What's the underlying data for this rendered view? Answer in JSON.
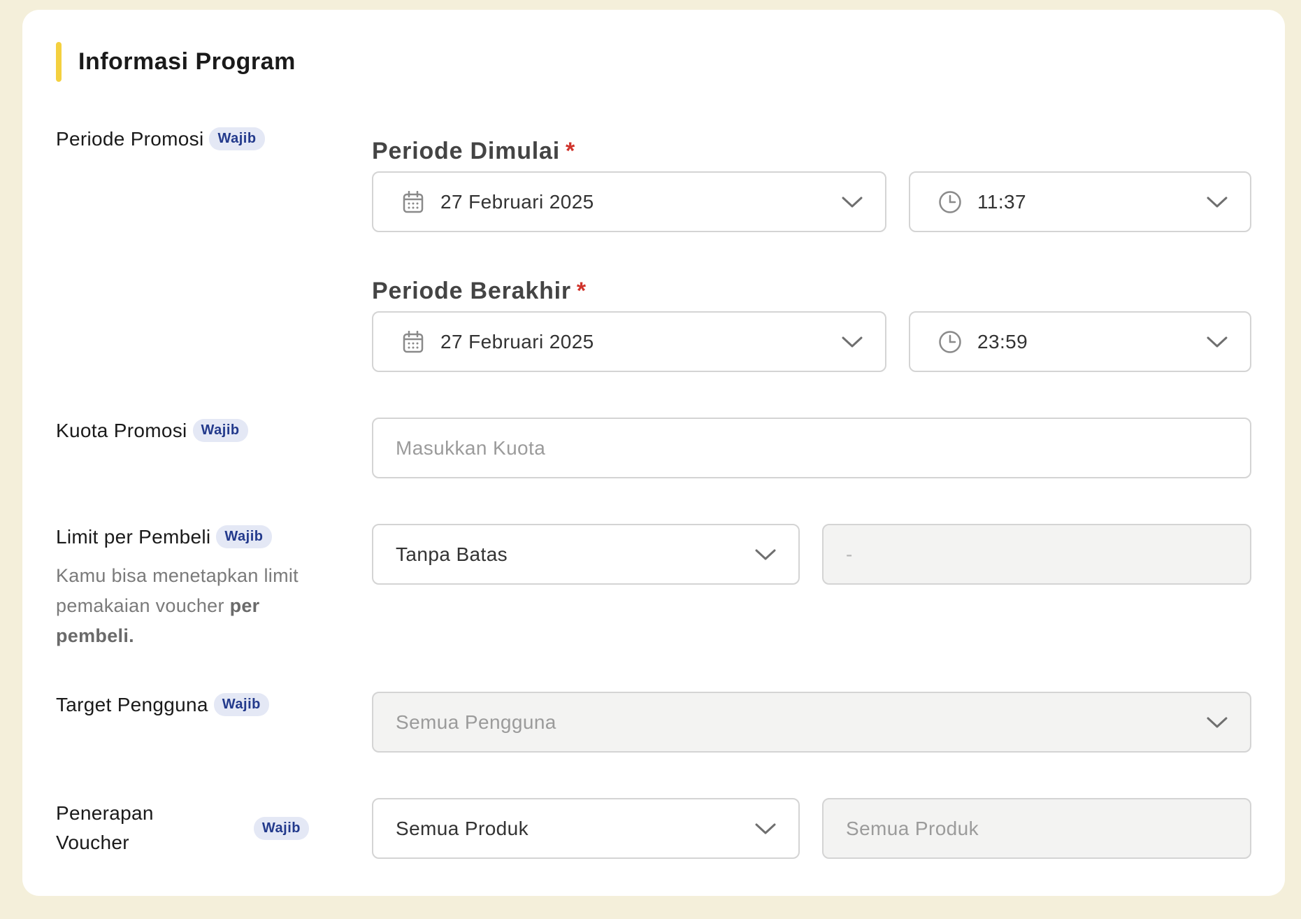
{
  "section": {
    "title": "Informasi Program"
  },
  "badge": "Wajib",
  "periode_promosi": {
    "label": "Periode Promosi",
    "start": {
      "label": "Periode Dimulai",
      "required": "*",
      "date": "27 Februari 2025",
      "time": "11:37"
    },
    "end": {
      "label": "Periode Berakhir",
      "required": "*",
      "date": "27 Februari 2025",
      "time": "23:59"
    }
  },
  "kuota_promosi": {
    "label": "Kuota Promosi",
    "placeholder": "Masukkan Kuota"
  },
  "limit_pembeli": {
    "label": "Limit per Pembeli",
    "helper_text": "Kamu bisa menetapkan limit pemakaian voucher",
    "helper_bold": "per pembeli.",
    "select_value": "Tanpa Batas",
    "value_placeholder": "-"
  },
  "target_pengguna": {
    "label": "Target Pengguna",
    "placeholder": "Semua Pengguna"
  },
  "penerapan_voucher": {
    "label": "Penerapan Voucher",
    "select_value": "Semua Produk",
    "value_placeholder": "Semua Produk"
  },
  "icons": {
    "calendar": "calendar-icon",
    "clock": "clock-icon",
    "chevron": "chevron-down-icon"
  },
  "colors": {
    "page_bg": "#f4efda",
    "accent": "#f4d03f",
    "badge_bg": "#e4e8f5",
    "badge_text": "#233a8c",
    "required": "#d0342c"
  }
}
